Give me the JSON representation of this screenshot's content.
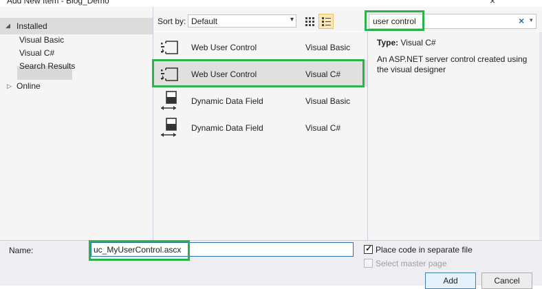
{
  "window": {
    "title": "Add New Item - Blog_Demo",
    "close_glyph": "×"
  },
  "tree": {
    "installed": "Installed",
    "items": [
      "Visual Basic",
      "Visual C#",
      "Search Results"
    ],
    "selected": "Search Results",
    "online": "Online",
    "expanded_glyph": "◢",
    "collapsed_glyph": "▷"
  },
  "toolbar": {
    "sort_label": "Sort by:",
    "sort_value": "Default",
    "dropdown_glyph": "▾"
  },
  "search": {
    "value": "user control",
    "clear_glyph": "×",
    "dropdown_glyph": "▾"
  },
  "templates": [
    {
      "name": "Web User Control",
      "language": "Visual Basic",
      "icon": "web-user-control-icon"
    },
    {
      "name": "Web User Control",
      "language": "Visual C#",
      "icon": "web-user-control-icon"
    },
    {
      "name": "Dynamic Data Field",
      "language": "Visual Basic",
      "icon": "dynamic-data-field-icon"
    },
    {
      "name": "Dynamic Data Field",
      "language": "Visual C#",
      "icon": "dynamic-data-field-icon"
    }
  ],
  "selected_template_index": 1,
  "details": {
    "type_label": "Type:",
    "type_value": "Visual C#",
    "description": "An ASP.NET server control created using the visual designer"
  },
  "bottom": {
    "name_label": "Name:",
    "name_value": "uc_MyUserControl.ascx",
    "separate_file_label": "Place code in separate file",
    "separate_file_checked": true,
    "master_page_label": "Select master page",
    "master_page_checked": false,
    "master_page_enabled": false,
    "check_glyph": "✓",
    "add_label": "Add",
    "cancel_label": "Cancel"
  },
  "colors": {
    "annotation_green": "#2db24b",
    "selection_gray": "#e0e0e0",
    "panel_bg": "#f5f5f5",
    "accent_blue": "#2a6fb4"
  }
}
